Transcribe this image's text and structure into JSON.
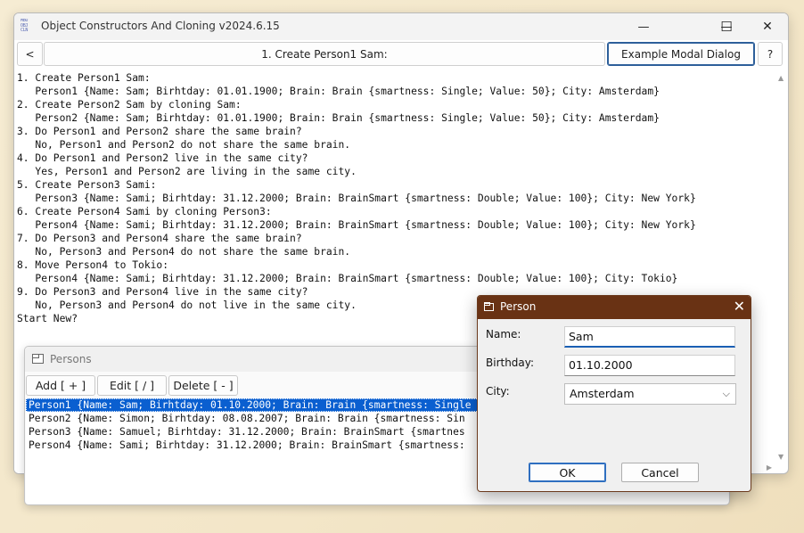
{
  "main_window": {
    "title": "Object Constructors And Cloning v2024.6.15",
    "app_icon_text": "MBO OBJ CLN",
    "controls": {
      "minimize": "—",
      "maximize": "☐",
      "close": "✕"
    },
    "toolbar": {
      "back_label": "<",
      "step_label": "1. Create Person1 Sam:",
      "modal_label": "Example Modal Dialog",
      "help_label": "?"
    },
    "output_lines": [
      "1. Create Person1 Sam:",
      "   Person1 {Name: Sam; Birhtday: 01.01.1900; Brain: Brain {smartness: Single; Value: 50}; City: Amsterdam}",
      "2. Create Person2 Sam by cloning Sam:",
      "   Person2 {Name: Sam; Birhtday: 01.01.1900; Brain: Brain {smartness: Single; Value: 50}; City: Amsterdam}",
      "3. Do Person1 and Person2 share the same brain?",
      "   No, Person1 and Person2 do not share the same brain.",
      "4. Do Person1 and Person2 live in the same city?",
      "   Yes, Person1 and Person2 are living in the same city.",
      "5. Create Person3 Sami:",
      "   Person3 {Name: Sami; Birhtday: 31.12.2000; Brain: BrainSmart {smartness: Double; Value: 100}; City: New York}",
      "6. Create Person4 Sami by cloning Person3:",
      "   Person4 {Name: Sami; Birhtday: 31.12.2000; Brain: BrainSmart {smartness: Double; Value: 100}; City: New York}",
      "7. Do Person3 and Person4 share the same brain?",
      "   No, Person3 and Person4 do not share the same brain.",
      "8. Move Person4 to Tokio:",
      "   Person4 {Name: Sami; Birhtday: 31.12.2000; Brain: BrainSmart {smartness: Double; Value: 100}; City: Tokio}",
      "9. Do Person3 and Person4 live in the same city?",
      "   No, Person3 and Person4 do not live in the same city.",
      "Start New?"
    ]
  },
  "persons_window": {
    "title": "Persons",
    "add_label": "Add [ + ]",
    "edit_label": "Edit [ / ]",
    "delete_label": "Delete [ - ]",
    "rows": [
      "Person1 {Name: Sam; Birhtday: 01.10.2000; Brain: Brain {smartness: Single",
      "Person2 {Name: Simon; Birhtday: 08.08.2007; Brain: Brain {smartness: Sin",
      "Person3 {Name: Samuel; Birhtday: 31.12.2000; Brain: BrainSmart {smartnes",
      "Person4 {Name: Sami; Birhtday: 31.12.2000; Brain: BrainSmart {smartness:"
    ],
    "selected_index": 0
  },
  "person_dialog": {
    "title": "Person",
    "name_label": "Name:",
    "name_value": "Sam",
    "birthday_label": "Birthday:",
    "birthday_value": "01.10.2000",
    "city_label": "City:",
    "city_value": "Amsterdam",
    "ok_label": "OK",
    "cancel_label": "Cancel"
  },
  "colors": {
    "dialog_titlebar": "#693214",
    "selection": "#0a5fd0",
    "accent_border": "#2d5f9a"
  }
}
